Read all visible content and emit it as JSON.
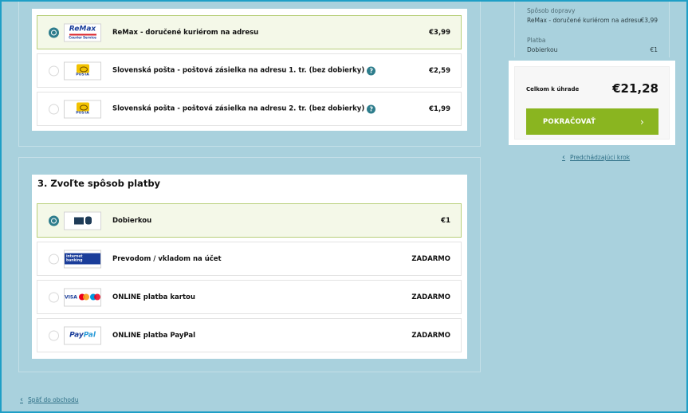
{
  "shipping": {
    "options": [
      {
        "label": "ReMax - doručené kuriérom na adresu",
        "price": "€3,99",
        "logo": "remax-logo",
        "selected": true,
        "help": false
      },
      {
        "label": "Slovenská pošta - poštová zásielka na adresu 1. tr. (bez dobierky)",
        "price": "€2,59",
        "logo": "posta-logo",
        "selected": false,
        "help": true
      },
      {
        "label": "Slovenská pošta - poštová zásielka na adresu 2. tr. (bez dobierky)",
        "price": "€1,99",
        "logo": "posta-logo",
        "selected": false,
        "help": true
      }
    ],
    "logos": {
      "remax_text": "ReMax",
      "remax_sub": "Courier Service",
      "posta_text": "POŠTA"
    }
  },
  "payment": {
    "title": "3. Zvoľte spôsob platby",
    "options": [
      {
        "label": "Dobierkou",
        "price": "€1",
        "logo": "cash-on-delivery-icon",
        "selected": true
      },
      {
        "label": "Prevodom / vkladom na účet",
        "price": "ZADARMO",
        "logo": "internet-banking-logo",
        "selected": false
      },
      {
        "label": "ONLINE platba kartou",
        "price": "ZADARMO",
        "logo": "card-brands-logo",
        "selected": false
      },
      {
        "label": "ONLINE platba PayPal",
        "price": "ZADARMO",
        "logo": "paypal-logo",
        "selected": false
      }
    ],
    "logos": {
      "internet_banking": "internet banking",
      "visa": "VISA",
      "paypal_pay": "Pay",
      "paypal_pal": "Pal"
    }
  },
  "summary": {
    "shipping_label": "Spôsob dopravy",
    "shipping_value": "ReMax - doručené kuriérom na adresu",
    "shipping_price": "€3,99",
    "payment_label": "Platba",
    "payment_value": "Dobierkou",
    "payment_price": "€1",
    "total_label": "Celkom k úhrade",
    "total_amount": "€21,28",
    "continue_label": "POKRAČOVAŤ"
  },
  "links": {
    "previous_step": "Predchádzajúci krok",
    "back_to_shop": "Späť do obchodu"
  },
  "colors": {
    "background": "#a9d1dd",
    "accent_green": "#8ab520",
    "radio_teal": "#2e7d8c",
    "selected_bg": "#f4f8e8"
  }
}
